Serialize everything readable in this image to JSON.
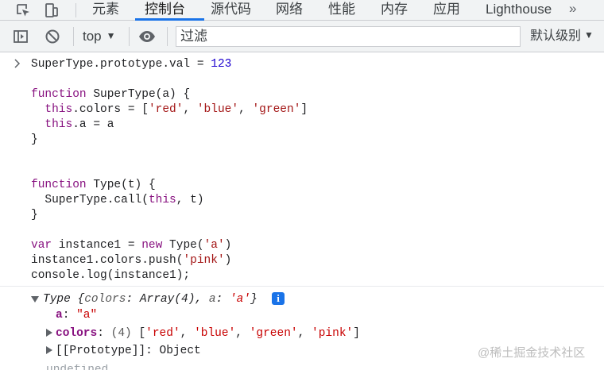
{
  "tabs": [
    {
      "label": "元素"
    },
    {
      "label": "控制台"
    },
    {
      "label": "源代码"
    },
    {
      "label": "网络"
    },
    {
      "label": "性能"
    },
    {
      "label": "内存"
    },
    {
      "label": "应用"
    },
    {
      "label": "Lighthouse"
    }
  ],
  "toolbar": {
    "context": "top",
    "filter_placeholder": "过滤",
    "levels": "默认级别"
  },
  "code": {
    "l1": {
      "a": "SuperType.prototype.val = ",
      "b": "123"
    },
    "l3": {
      "kw": "function",
      "rest": " SuperType(a) {"
    },
    "l4": {
      "kw": "this",
      "a": ".colors = [",
      "s1": "'red'",
      "c1": ", ",
      "s2": "'blue'",
      "c2": ", ",
      "s3": "'green'",
      "e": "]"
    },
    "l5": {
      "kw": "this",
      "a": ".a = a"
    },
    "l6": "}",
    "l9": {
      "kw": "function",
      "rest": " Type(t) {"
    },
    "l10": {
      "a": "SuperType.call(",
      "kw": "this",
      "b": ", t)"
    },
    "l11": "}",
    "l13": {
      "kw1": "var",
      "a": " instance1 = ",
      "kw2": "new",
      "b": " Type(",
      "s": "'a'",
      "e": ")"
    },
    "l14": {
      "a": "instance1.colors.push(",
      "s": "'pink'",
      "e": ")"
    },
    "l15": "console.log(instance1);"
  },
  "result": {
    "summary": {
      "type": "Type",
      "open": " {",
      "k1": "colors",
      "v1": ": Array(4), ",
      "k2": "a",
      "sep": ": ",
      "v2": "'a'",
      "close": "}"
    },
    "info": "i",
    "prop_a": {
      "key": "a",
      "sep": ": ",
      "value": "\"a\""
    },
    "prop_colors": {
      "key": "colors",
      "sep": ": ",
      "count": "(4) ",
      "o": "[",
      "s1": "'red'",
      "c1": ", ",
      "s2": "'blue'",
      "c2": ", ",
      "s3": "'green'",
      "c3": ", ",
      "s4": "'pink'",
      "e": "]"
    },
    "prop_proto": {
      "key": "[[Prototype]]",
      "sep": ": ",
      "value": "Object"
    },
    "cut": "undefined"
  },
  "watermark": "@稀土掘金技术社区"
}
